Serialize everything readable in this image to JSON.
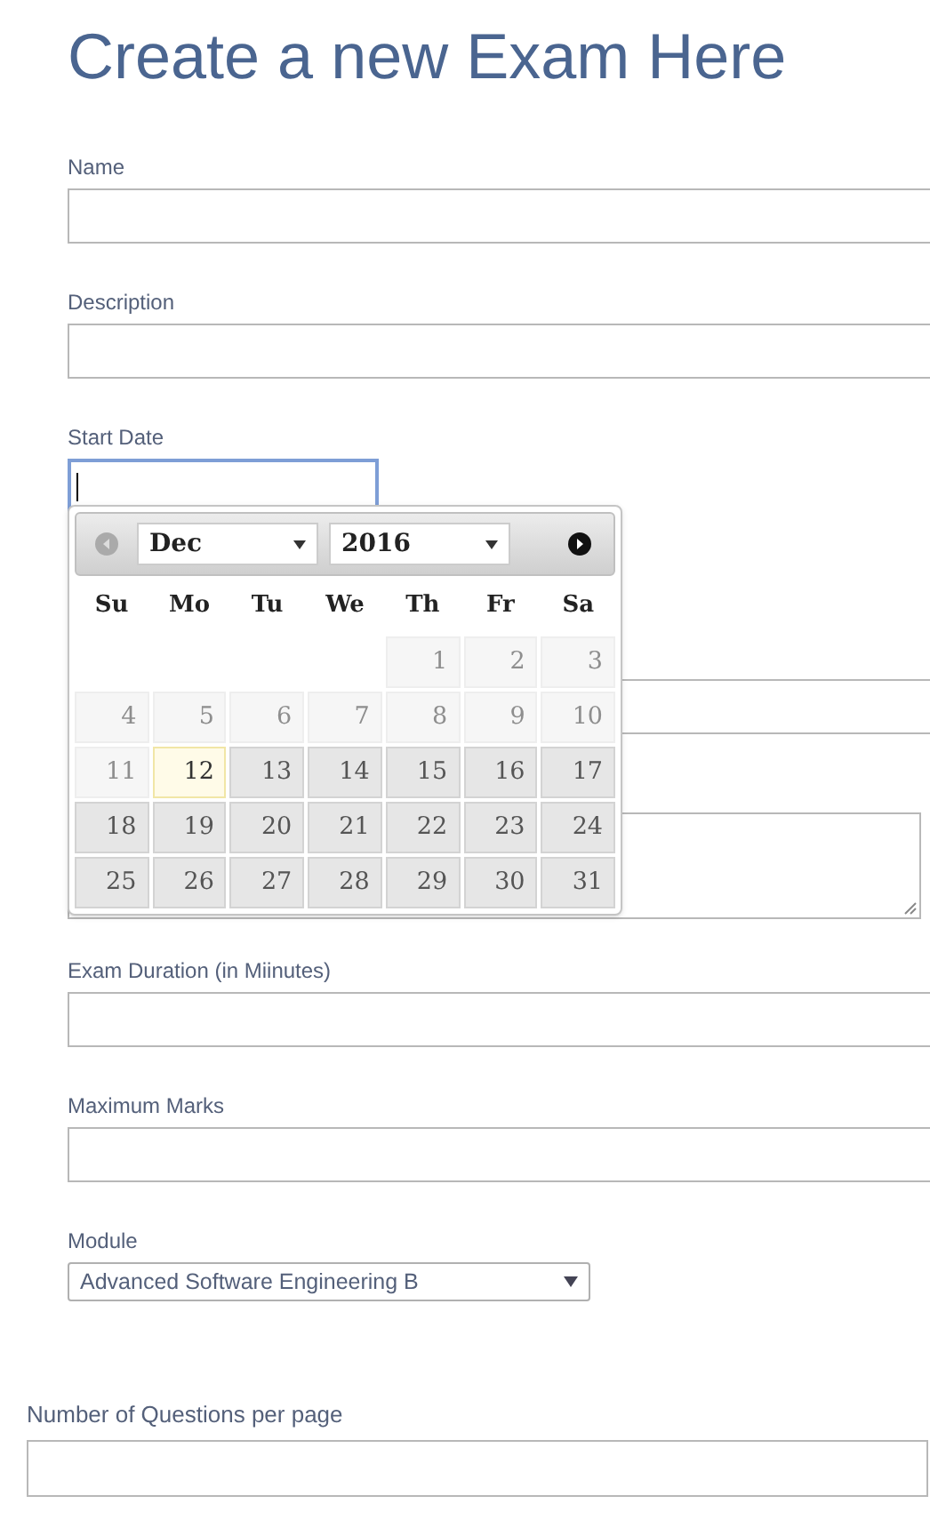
{
  "title": "Create a new Exam Here",
  "fields": [
    {
      "kind": "input",
      "label": "Name"
    },
    {
      "kind": "input",
      "label": "Description"
    },
    {
      "kind": "date",
      "label": "Start Date",
      "focused": true
    },
    {
      "kind": "covered_input"
    },
    {
      "kind": "covered_textarea"
    },
    {
      "kind": "input",
      "label": "Exam Duration (in Miinutes)"
    },
    {
      "kind": "input",
      "label": "Maximum Marks"
    },
    {
      "kind": "select",
      "label": "Module",
      "value": "Advanced Software Engineering B"
    },
    {
      "kind": "wide_input",
      "label": "Number of Questions per page"
    }
  ],
  "datepicker": {
    "month": "Dec",
    "year": "2016",
    "prev_disabled": true,
    "weekdays": [
      "Su",
      "Mo",
      "Tu",
      "We",
      "Th",
      "Fr",
      "Sa"
    ],
    "days": [
      {
        "kind": "empty"
      },
      {
        "kind": "empty"
      },
      {
        "kind": "empty"
      },
      {
        "kind": "empty"
      },
      {
        "label": "1",
        "disabled": true,
        "today": false
      },
      {
        "label": "2",
        "disabled": true,
        "today": false
      },
      {
        "label": "3",
        "disabled": true,
        "today": false
      },
      {
        "label": "4",
        "disabled": true,
        "today": false
      },
      {
        "label": "5",
        "disabled": true,
        "today": false
      },
      {
        "label": "6",
        "disabled": true,
        "today": false
      },
      {
        "label": "7",
        "disabled": true,
        "today": false
      },
      {
        "label": "8",
        "disabled": true,
        "today": false
      },
      {
        "label": "9",
        "disabled": true,
        "today": false
      },
      {
        "label": "10",
        "disabled": true,
        "today": false
      },
      {
        "label": "11",
        "disabled": true,
        "today": false
      },
      {
        "label": "12",
        "disabled": false,
        "today": true
      },
      {
        "label": "13",
        "disabled": false,
        "today": false
      },
      {
        "label": "14",
        "disabled": false,
        "today": false
      },
      {
        "label": "15",
        "disabled": false,
        "today": false
      },
      {
        "label": "16",
        "disabled": false,
        "today": false
      },
      {
        "label": "17",
        "disabled": false,
        "today": false
      },
      {
        "label": "18",
        "disabled": false,
        "today": false
      },
      {
        "label": "19",
        "disabled": false,
        "today": false
      },
      {
        "label": "20",
        "disabled": false,
        "today": false
      },
      {
        "label": "21",
        "disabled": false,
        "today": false
      },
      {
        "label": "22",
        "disabled": false,
        "today": false
      },
      {
        "label": "23",
        "disabled": false,
        "today": false
      },
      {
        "label": "24",
        "disabled": false,
        "today": false
      },
      {
        "label": "25",
        "disabled": false,
        "today": false
      },
      {
        "label": "26",
        "disabled": false,
        "today": false
      },
      {
        "label": "27",
        "disabled": false,
        "today": false
      },
      {
        "label": "28",
        "disabled": false,
        "today": false
      },
      {
        "label": "29",
        "disabled": false,
        "today": false
      },
      {
        "label": "30",
        "disabled": false,
        "today": false
      },
      {
        "label": "31",
        "disabled": false,
        "today": false
      }
    ]
  }
}
